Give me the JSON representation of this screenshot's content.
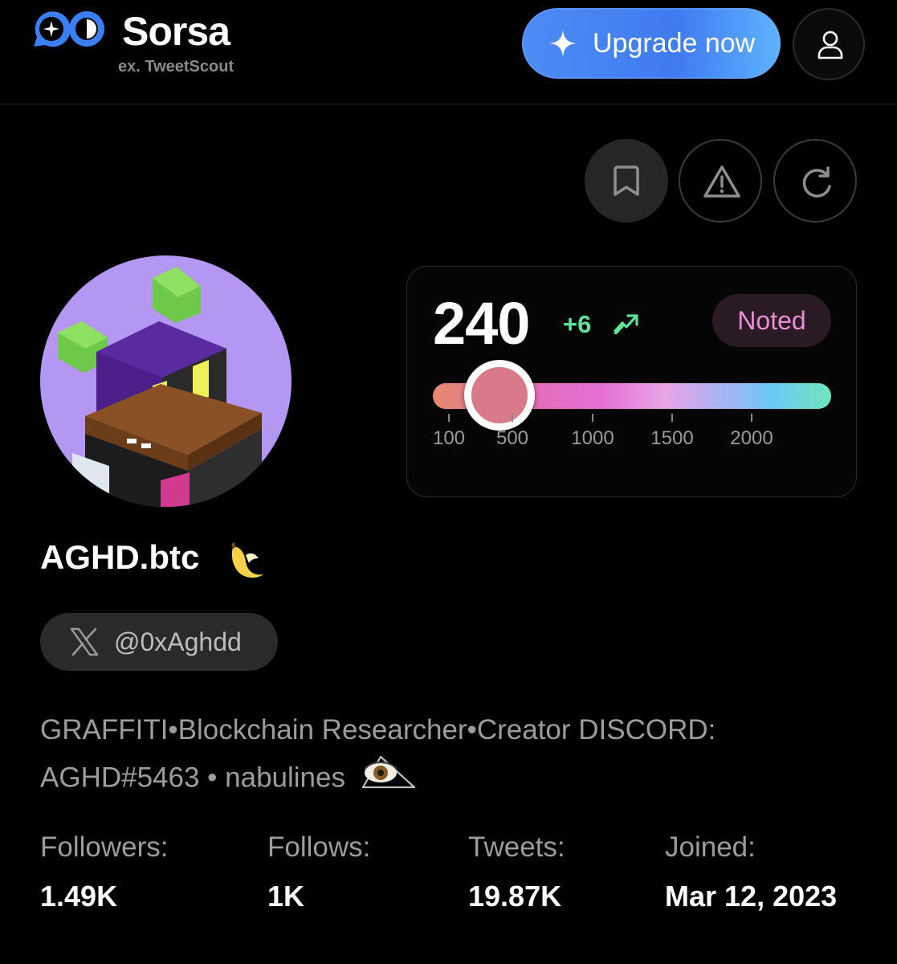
{
  "header": {
    "brand": "Sorsa",
    "brand_sub": "ex. TweetScout",
    "upgrade_label": "Upgrade now"
  },
  "icons": {
    "logo": "sorsa-logo-icon",
    "upgrade": "sparkle-icon",
    "user": "user-icon",
    "bookmark": "bookmark-icon",
    "report": "warning-icon",
    "refresh": "refresh-icon",
    "trend": "trending-up-icon",
    "x": "x-logo-icon"
  },
  "score_card": {
    "score": "240",
    "delta": "+6",
    "badge": "Noted",
    "slider_value": 240,
    "ticks": [
      "100",
      "500",
      "1000",
      "1500",
      "2000"
    ]
  },
  "profile": {
    "name": "AGHD.btc",
    "handle": "@0xAghdd",
    "bio": "GRAFFITI•Blockchain Researcher•Creator DISCORD: AGHD#5463 • nabulines"
  },
  "stats": [
    {
      "label": "Followers:",
      "value": "1.49K"
    },
    {
      "label": "Follows:",
      "value": "1K"
    },
    {
      "label": "Tweets:",
      "value": "19.87K"
    },
    {
      "label": "Joined:",
      "value": "Mar 12, 2023"
    }
  ],
  "colors": {
    "accent": "#4d8cf6",
    "positive": "#5ee39a",
    "badge_text": "#e98fd7",
    "avatar_bg": "#b497f2"
  }
}
